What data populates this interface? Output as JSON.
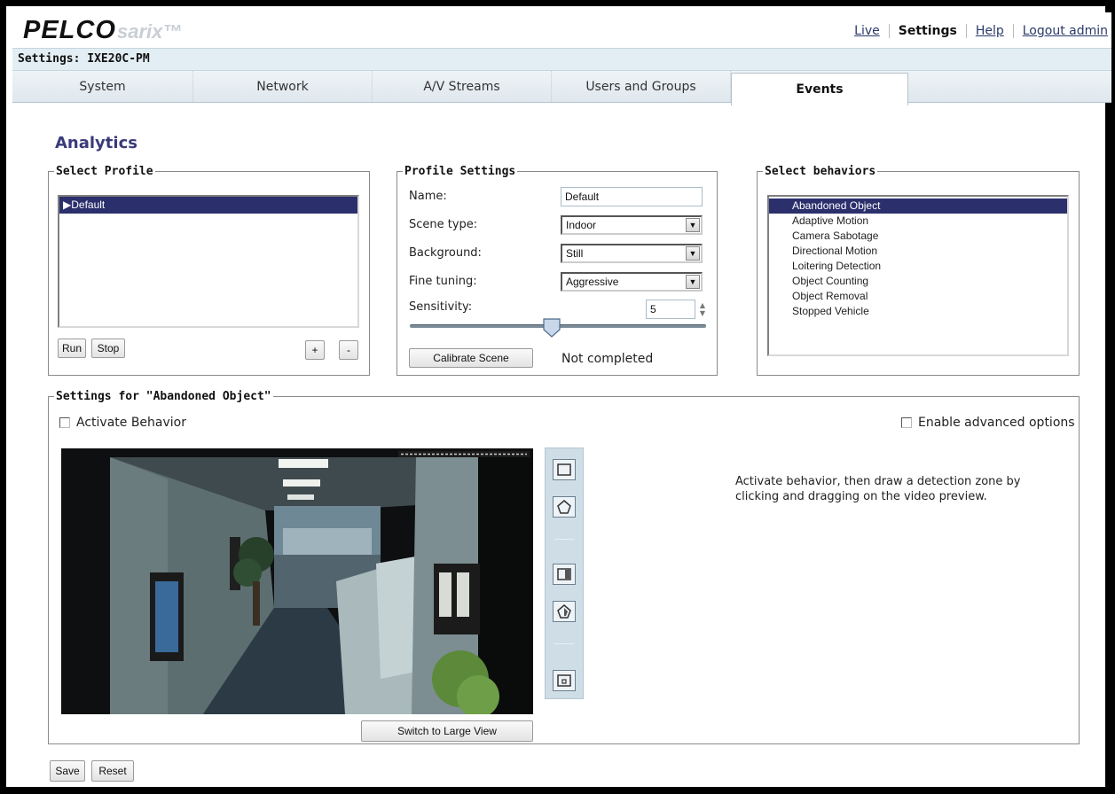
{
  "header": {
    "logo": "PELCO",
    "logo_sub": "sarix™",
    "links": [
      "Live",
      "Settings",
      "Help",
      "Logout admin"
    ],
    "active_link": "Settings"
  },
  "title_bar": "Settings: IXE20C-PM",
  "tabs": [
    {
      "label": "System"
    },
    {
      "label": "Network"
    },
    {
      "label": "A/V Streams"
    },
    {
      "label": "Users and Groups"
    },
    {
      "label": "Events",
      "active": true
    }
  ],
  "page_title": "Analytics",
  "select_profile": {
    "legend": "Select Profile",
    "items": [
      "▶Default"
    ],
    "run_label": "Run",
    "stop_label": "Stop",
    "add_label": "+",
    "remove_label": "-"
  },
  "profile_settings": {
    "legend": "Profile Settings",
    "name_label": "Name:",
    "name_value": "Default",
    "scene_label": "Scene type:",
    "scene_value": "Indoor",
    "background_label": "Background:",
    "background_value": "Still",
    "fine_label": "Fine tuning:",
    "fine_value": "Aggressive",
    "sensitivity_label": "Sensitivity:",
    "sensitivity_value": "5",
    "slider_fraction": 0.48,
    "calibrate_label": "Calibrate Scene",
    "calibrate_status": "Not completed"
  },
  "select_behaviors": {
    "legend": "Select behaviors",
    "items": [
      "Abandoned Object",
      "Adaptive Motion",
      "Camera Sabotage",
      "Directional Motion",
      "Loitering Detection",
      "Object Counting",
      "Object Removal",
      "Stopped Vehicle"
    ],
    "selected": 0
  },
  "behavior_settings": {
    "legend": "Settings for \"Abandoned Object\"",
    "activate_label": "Activate Behavior",
    "advanced_label": "Enable advanced options",
    "instructions": "Activate behavior, then draw a detection zone by clicking and dragging on the video preview.",
    "switch_view_label": "Switch to Large View",
    "tools": [
      "rectangle-zone-icon",
      "polygon-zone-icon",
      "rectangle-exclude-icon",
      "polygon-exclude-icon",
      "object-size-icon"
    ]
  },
  "footer": {
    "save_label": "Save",
    "reset_label": "Reset"
  },
  "colors": {
    "selection": "#2b2f6c",
    "title": "#3a3a7a",
    "tab_bar": "#e3eef4"
  }
}
